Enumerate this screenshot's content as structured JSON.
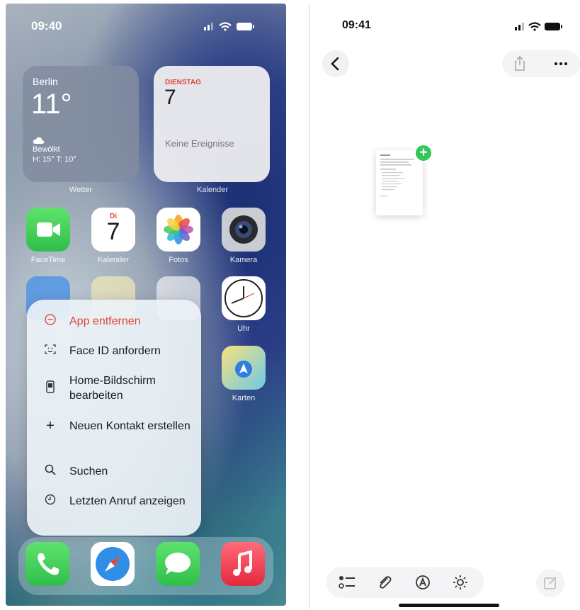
{
  "left_phone": {
    "status_time": "09:40",
    "weather_widget": {
      "city": "Berlin",
      "temperature": "11°",
      "condition": "Bewölkt",
      "range": "H: 15° T: 10°",
      "label": "Wetter"
    },
    "calendar_widget": {
      "weekday": "DIENSTAG",
      "day": "7",
      "events": "Keine Ereignisse",
      "label": "Kalender"
    },
    "apps_row1": [
      {
        "label": "FaceTime",
        "icon": "facetime-icon"
      },
      {
        "label": "Kalender",
        "icon": "calendar-icon",
        "weekday": "Di",
        "day": "7"
      },
      {
        "label": "Fotos",
        "icon": "photos-icon"
      },
      {
        "label": "Kamera",
        "icon": "camera-icon"
      }
    ],
    "apps_row2_visible": [
      {
        "label": "Uhr",
        "icon": "clock-icon"
      }
    ],
    "apps_row3_visible": [
      {
        "label": "Karten",
        "icon": "maps-icon"
      }
    ],
    "context_menu": [
      {
        "label": "App entfernen",
        "icon": "minus-circle-icon",
        "color": "#e0453a"
      },
      {
        "label": "Face ID anfordern",
        "icon": "face-id-icon"
      },
      {
        "label": "Home-Bildschirm bearbeiten",
        "icon": "phone-edit-icon"
      },
      {
        "label": "Neuen Kontakt erstellen",
        "icon": "plus-icon"
      },
      {
        "label": "Suchen",
        "icon": "search-icon"
      },
      {
        "label": "Letzten Anruf anzeigen",
        "icon": "clock-icon"
      }
    ],
    "dock": [
      {
        "name": "Telefon",
        "icon": "phone-icon"
      },
      {
        "name": "Safari",
        "icon": "safari-icon"
      },
      {
        "name": "Nachrichten",
        "icon": "messages-icon"
      },
      {
        "name": "Musik",
        "icon": "music-icon"
      }
    ]
  },
  "right_phone": {
    "status_time": "09:41",
    "nav": {
      "back": "back-icon",
      "share": "share-icon",
      "more": "more-icon"
    },
    "document_badge": "+",
    "toolbar": [
      "checklist-icon",
      "paperclip-icon",
      "markup-icon",
      "gear-icon",
      "compose-icon"
    ]
  }
}
